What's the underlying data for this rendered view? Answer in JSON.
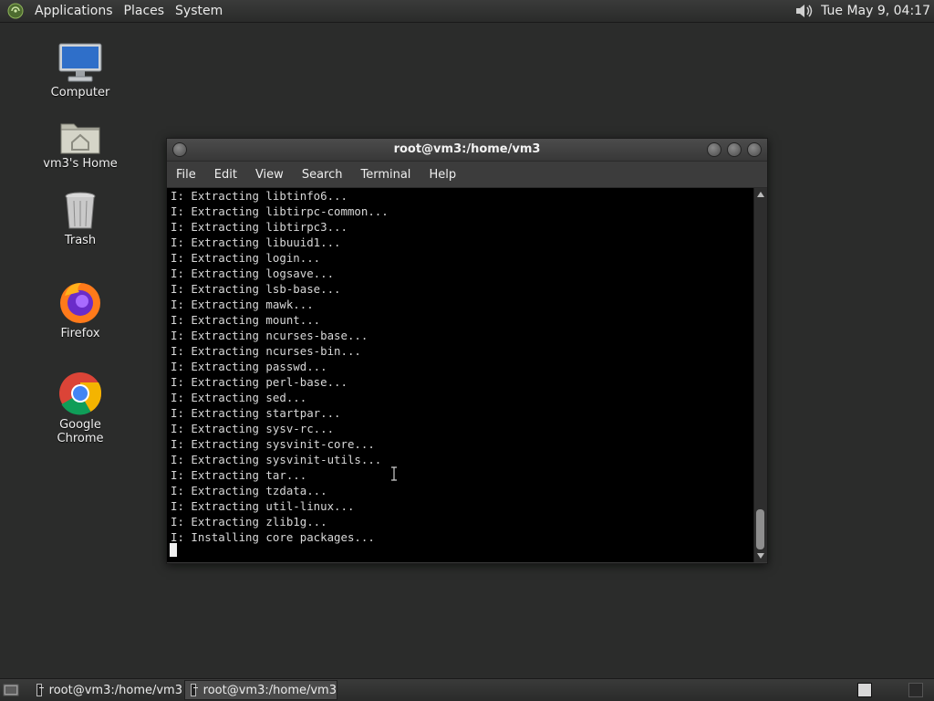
{
  "top_panel": {
    "menus": [
      "Applications",
      "Places",
      "System"
    ],
    "clock": "Tue May  9, 04:17"
  },
  "desktop_icons": [
    {
      "label": "Computer",
      "icon": "computer-icon"
    },
    {
      "label": "vm3's Home",
      "icon": "home-folder-icon"
    },
    {
      "label": "Trash",
      "icon": "trash-icon"
    },
    {
      "label": "Firefox",
      "icon": "firefox-icon"
    },
    {
      "label": "Google Chrome",
      "icon": "chrome-icon"
    }
  ],
  "terminal": {
    "title": "root@vm3:/home/vm3",
    "menu": [
      "File",
      "Edit",
      "View",
      "Search",
      "Terminal",
      "Help"
    ],
    "lines": [
      "I: Extracting libtinfo6...",
      "I: Extracting libtirpc-common...",
      "I: Extracting libtirpc3...",
      "I: Extracting libuuid1...",
      "I: Extracting login...",
      "I: Extracting logsave...",
      "I: Extracting lsb-base...",
      "I: Extracting mawk...",
      "I: Extracting mount...",
      "I: Extracting ncurses-base...",
      "I: Extracting ncurses-bin...",
      "I: Extracting passwd...",
      "I: Extracting perl-base...",
      "I: Extracting sed...",
      "I: Extracting startpar...",
      "I: Extracting sysv-rc...",
      "I: Extracting sysvinit-core...",
      "I: Extracting sysvinit-utils...",
      "I: Extracting tar...",
      "I: Extracting tzdata...",
      "I: Extracting util-linux...",
      "I: Extracting zlib1g...",
      "I: Installing core packages..."
    ]
  },
  "taskbar": {
    "tasks": [
      {
        "label": "root@vm3:/home/vm3",
        "active": false
      },
      {
        "label": "root@vm3:/home/vm3",
        "active": true
      }
    ]
  },
  "colors": {
    "desktop_bg": "#2b2c2b",
    "terminal_bg": "#000000",
    "terminal_fg": "#d8d8d8"
  }
}
